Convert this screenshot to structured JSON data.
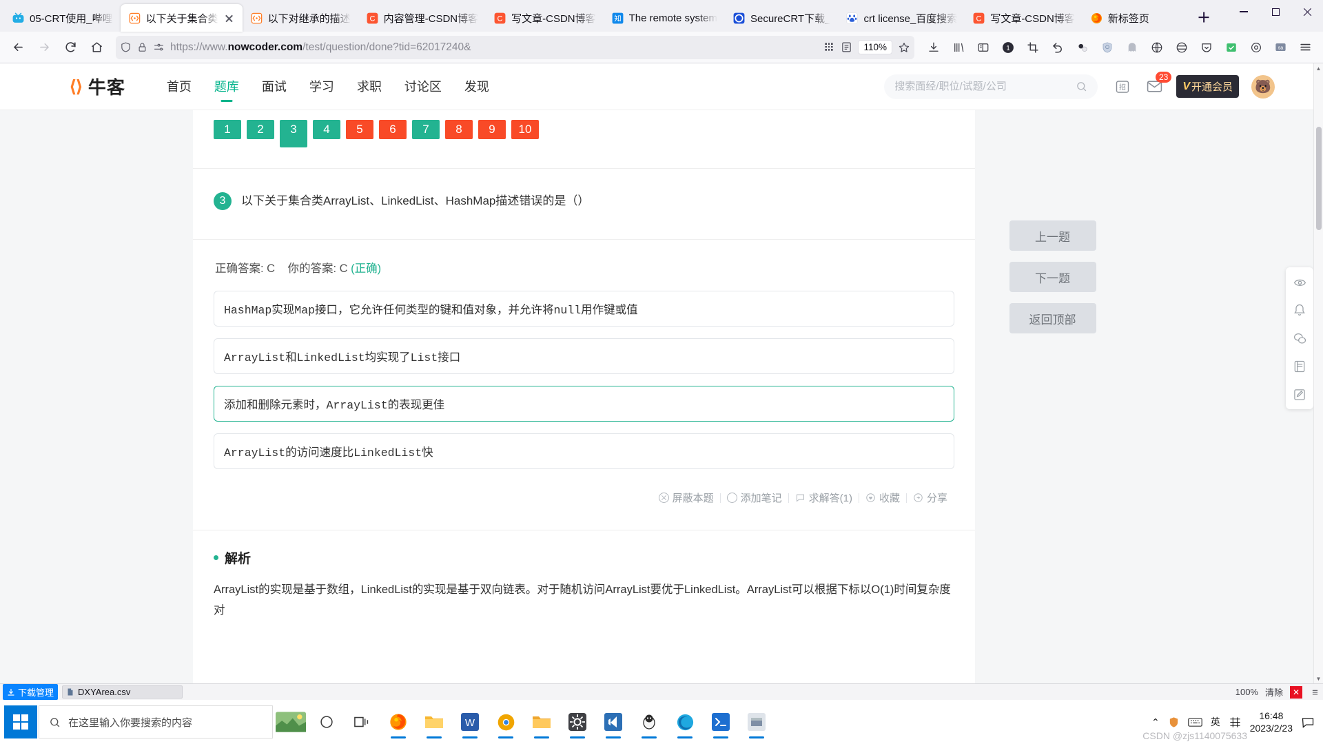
{
  "browser": {
    "tabs": [
      {
        "title": "05-CRT使用_哔哩",
        "favicon": "bilibili-icon",
        "active": false,
        "closable": false
      },
      {
        "title": "以下关于集合类",
        "favicon": "nowcoder-icon",
        "active": true,
        "closable": true
      },
      {
        "title": "以下对继承的描述",
        "favicon": "nowcoder-icon",
        "active": false,
        "closable": false
      },
      {
        "title": "内容管理-CSDN博客",
        "favicon": "csdn-icon",
        "active": false,
        "closable": false
      },
      {
        "title": "写文章-CSDN博客",
        "favicon": "csdn-icon",
        "active": false,
        "closable": false
      },
      {
        "title": "The remote system",
        "favicon": "zhihu-icon",
        "active": false,
        "closable": false
      },
      {
        "title": "SecureCRT下载_",
        "favicon": "securecrt-icon",
        "active": false,
        "closable": false
      },
      {
        "title": "crt license_百度搜索",
        "favicon": "baidu-icon",
        "active": false,
        "closable": false
      },
      {
        "title": "写文章-CSDN博客",
        "favicon": "csdn-icon",
        "active": false,
        "closable": false
      },
      {
        "title": "新标签页",
        "favicon": "firefox-icon",
        "active": false,
        "closable": false
      }
    ],
    "new_tab_label": "+",
    "window_controls": {
      "minimize": "—",
      "maximize": "□",
      "close": "✕"
    },
    "nav": {
      "back": "back-arrow",
      "forward": "forward-arrow",
      "reload": "reload",
      "home": "home"
    },
    "url": {
      "scheme": "https://www.",
      "domain": "nowcoder.com",
      "path": "/test/question/done?tid=62017240&",
      "full": "https://www.nowcoder.com/test/question/done?tid=62017240&"
    },
    "zoom_level": "110%",
    "toolbar_icons": [
      "shield-icon",
      "lock-icon",
      "permissions-icon",
      "qrcode-icon",
      "reader-mode-icon",
      "bookmark-star-icon",
      "downloads-icon",
      "library-icon",
      "sidebar-icon",
      "counter-badge-icon",
      "screenshot-crop-icon",
      "undo-icon",
      "tampermonkey-icon",
      "adblock-shield-icon",
      "ghostery-icon",
      "translate-icon",
      "globe-icon",
      "pocket-icon",
      "save-icon",
      "extension-icon",
      "account-icon",
      "app-menu-icon"
    ],
    "counter_badge": "1"
  },
  "site": {
    "logo_mark": "⟨⟩",
    "logo_word": "牛客",
    "nav": [
      {
        "label": "首页",
        "active": false
      },
      {
        "label": "题库",
        "active": true
      },
      {
        "label": "面试",
        "active": false
      },
      {
        "label": "学习",
        "active": false
      },
      {
        "label": "求职",
        "active": false
      },
      {
        "label": "讨论区",
        "active": false
      },
      {
        "label": "发现",
        "active": false
      }
    ],
    "search_placeholder": "搜索面经/职位/试题/公司",
    "search_value": "",
    "recruit_icon": "招",
    "message_badge": "23",
    "vip_label": "开通会员",
    "vip_v": "V",
    "avatar": "🐻",
    "accent_color": "#00b38a"
  },
  "quiz": {
    "question_nav": [
      {
        "n": "1",
        "state": "correct"
      },
      {
        "n": "2",
        "state": "correct"
      },
      {
        "n": "3",
        "state": "current"
      },
      {
        "n": "4",
        "state": "correct"
      },
      {
        "n": "5",
        "state": "wrong"
      },
      {
        "n": "6",
        "state": "wrong"
      },
      {
        "n": "7",
        "state": "correct"
      },
      {
        "n": "8",
        "state": "wrong"
      },
      {
        "n": "9",
        "state": "wrong"
      },
      {
        "n": "10",
        "state": "wrong"
      }
    ],
    "colors": {
      "correct": "#23b391",
      "wrong": "#f94a27"
    },
    "question_number": "3",
    "question_text": "以下关于集合类ArrayList、LinkedList、HashMap描述错误的是（）",
    "answer_line_prefix": "正确答案: C",
    "answer_line_yours": "你的答案: C",
    "answer_line_verdict": "(正确)",
    "options": [
      {
        "text": "HashMap实现Map接口，它允许任何类型的键和值对象，并允许将null用作键或值",
        "selected": false
      },
      {
        "text": "ArrayList和LinkedList均实现了List接口",
        "selected": false
      },
      {
        "text": "添加和删除元素时，ArrayList的表现更佳",
        "selected": true
      },
      {
        "text": "ArrayList的访问速度比LinkedList快",
        "selected": false
      }
    ],
    "actions": [
      {
        "label": "屏蔽本题",
        "icon": "block-icon"
      },
      {
        "label": "添加笔记",
        "icon": "note-icon"
      },
      {
        "label": "求解答(1)",
        "icon": "question-bubble-icon"
      },
      {
        "label": "收藏",
        "icon": "heart-icon"
      },
      {
        "label": "分享",
        "icon": "share-icon"
      }
    ],
    "analysis_title": "解析",
    "analysis_text": "ArrayList的实现是基于数组，LinkedList的实现是基于双向链表。对于随机访问ArrayList要优于LinkedList。ArrayList可以根据下标以O(1)时间复杂度对",
    "side_buttons": [
      {
        "label": "上一题"
      },
      {
        "label": "下一题"
      },
      {
        "label": "返回顶部"
      }
    ],
    "rail_icons": [
      "feedback-icon",
      "bell-icon",
      "wechat-icon",
      "book-icon",
      "edit-icon"
    ]
  },
  "downloads_bar": {
    "manager_label": "下载管理",
    "manager_icon": "download-icon",
    "file_name": "DXYArea.csv",
    "file_icon": "file-icon",
    "progress": "100%",
    "clear_label": "清除",
    "close_label": "✕",
    "menu_icon": "more-icon"
  },
  "taskbar": {
    "start_icon": "windows-logo",
    "search_placeholder": "在这里输入你要搜索的内容",
    "search_icon": "search-icon",
    "items": [
      {
        "name": "weather-widget-icon",
        "running": false
      },
      {
        "name": "cortana-circle-icon",
        "running": false
      },
      {
        "name": "task-view-icon",
        "running": false
      },
      {
        "name": "firefox-icon",
        "running": true
      },
      {
        "name": "file-explorer-icon",
        "running": true
      },
      {
        "name": "wps-writer-icon",
        "running": true
      },
      {
        "name": "chrome-canary-icon",
        "running": true
      },
      {
        "name": "folder-icon",
        "running": true
      },
      {
        "name": "settings-gear-icon",
        "running": true
      },
      {
        "name": "vscode-icon",
        "running": true
      },
      {
        "name": "qq-penguin-icon",
        "running": true
      },
      {
        "name": "edge-icon",
        "running": true
      },
      {
        "name": "terminal-blue-icon",
        "running": true
      },
      {
        "name": "screenshot-tool-icon",
        "running": true
      }
    ],
    "tray": {
      "chevron": "⌃",
      "icons": [
        "shield-tray-icon",
        "keyboard-icon",
        "input-lang",
        "pinyin-icon"
      ],
      "lang": "英",
      "time": "16:48",
      "date": "2023/2/23",
      "notification_icon": "action-center-icon"
    },
    "watermark": "CSDN @zjs1140075633"
  }
}
